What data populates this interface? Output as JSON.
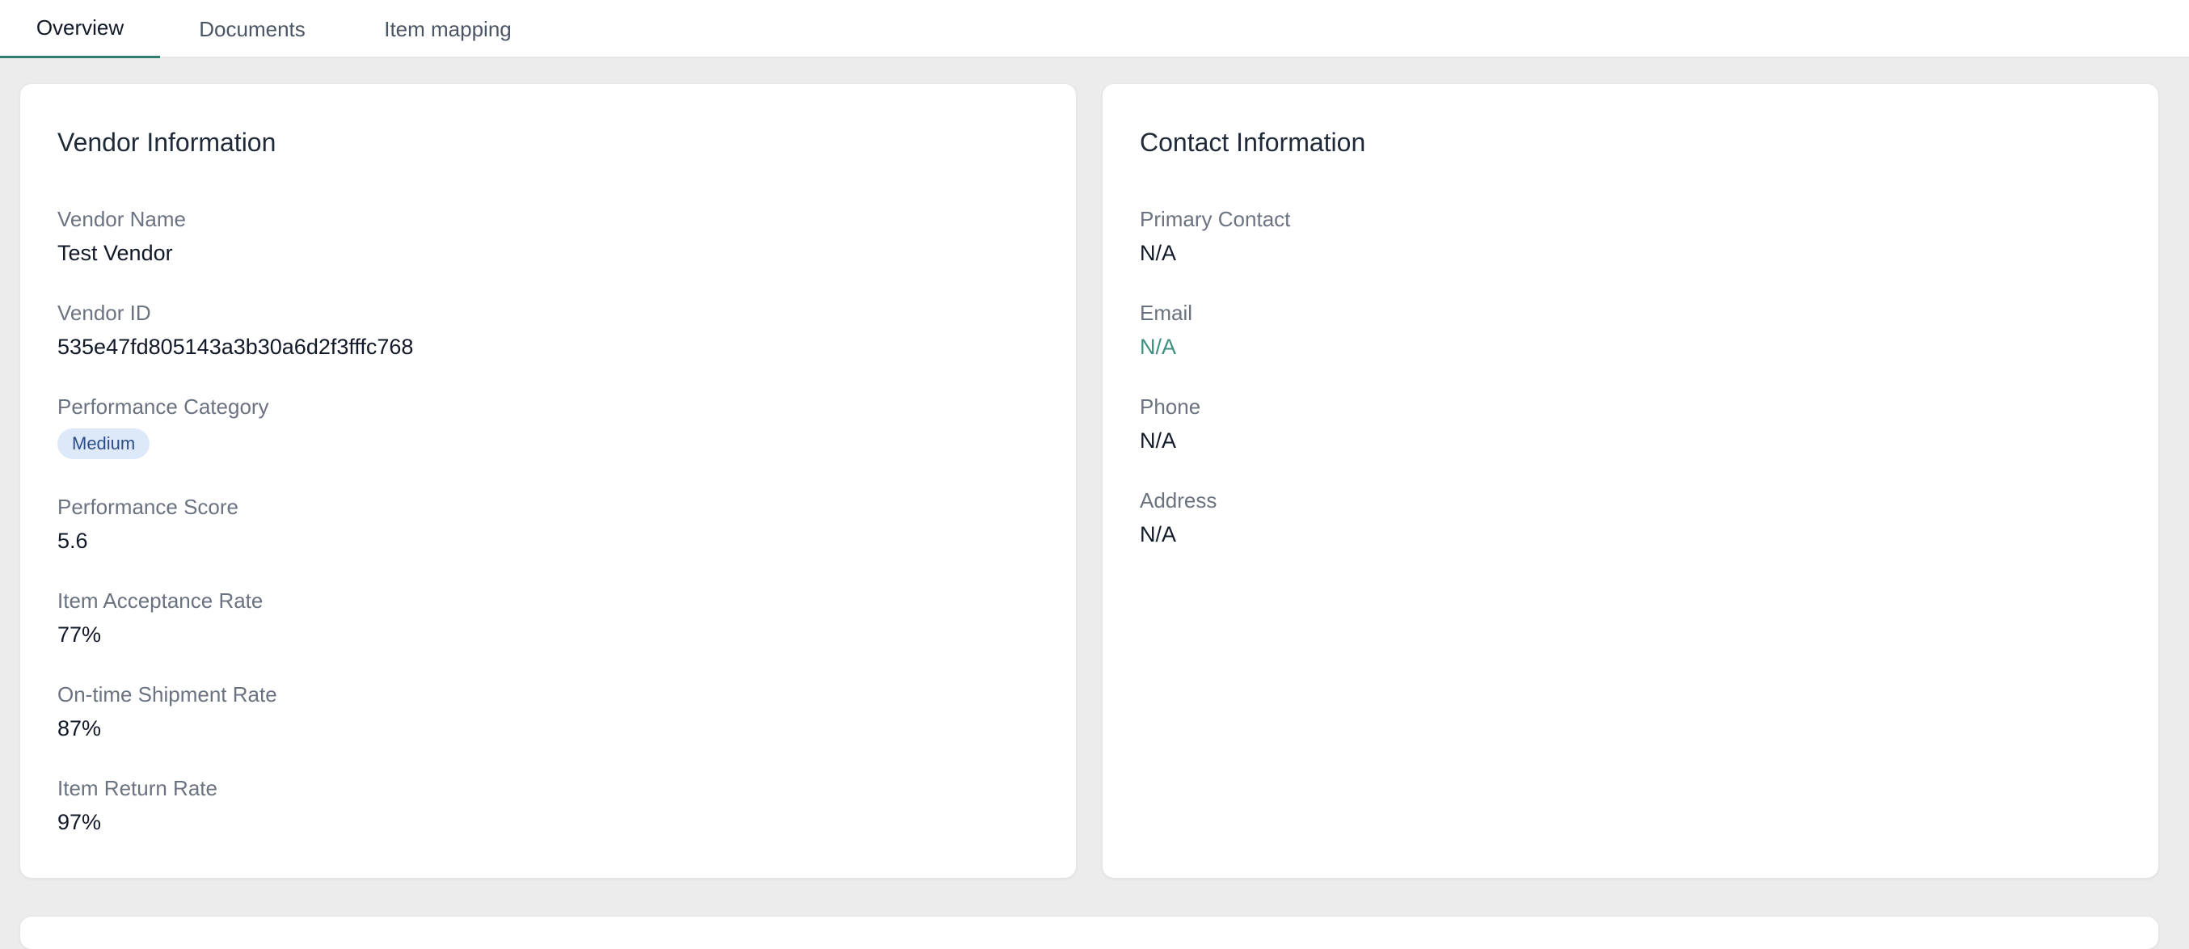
{
  "tabs": [
    {
      "label": "Overview",
      "active": true
    },
    {
      "label": "Documents",
      "active": false
    },
    {
      "label": "Item mapping",
      "active": false
    }
  ],
  "vendor_info": {
    "title": "Vendor Information",
    "fields": [
      {
        "label": "Vendor Name",
        "value": "Test Vendor"
      },
      {
        "label": "Vendor ID",
        "value": "535e47fd805143a3b30a6d2f3fffc768"
      },
      {
        "label": "Performance Category",
        "value": "Medium"
      },
      {
        "label": "Performance Score",
        "value": "5.6"
      },
      {
        "label": "Item Acceptance Rate",
        "value": "77%"
      },
      {
        "label": "On-time Shipment Rate",
        "value": "87%"
      },
      {
        "label": "Item Return Rate",
        "value": "97%"
      }
    ]
  },
  "contact_info": {
    "title": "Contact Information",
    "fields": [
      {
        "label": "Primary Contact",
        "value": "N/A"
      },
      {
        "label": "Email",
        "value": "N/A"
      },
      {
        "label": "Phone",
        "value": "N/A"
      },
      {
        "label": "Address",
        "value": "N/A"
      }
    ]
  },
  "colors": {
    "accent": "#2f7d6d",
    "link": "#3f8f7f",
    "badge_bg": "#dde9f8",
    "badge_text": "#2c4d8a",
    "page_bg": "#ececec"
  }
}
